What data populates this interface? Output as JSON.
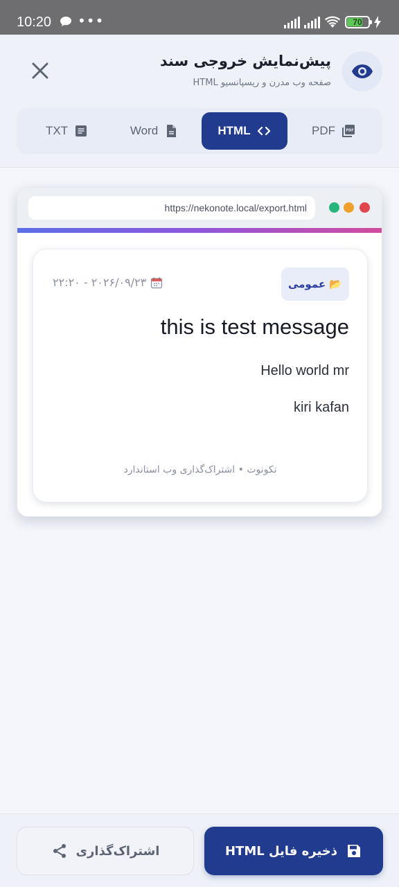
{
  "status_bar": {
    "time": "10:20",
    "dots": "•••",
    "battery": "70"
  },
  "header": {
    "title": "پیش‌نمایش خروجی سند",
    "subtitle": "صفحه وب مدرن و ریسپانسیو HTML"
  },
  "tabs": [
    {
      "label": "PDF",
      "icon": "pdf-icon",
      "active": false
    },
    {
      "label": "HTML",
      "icon": "code-icon",
      "active": true
    },
    {
      "label": "Word",
      "icon": "document-icon",
      "active": false
    },
    {
      "label": "TXT",
      "icon": "text-icon",
      "active": false
    }
  ],
  "browser": {
    "url": "https://nekonote.local/export.html",
    "dot_colors": [
      "#e0474c",
      "#f0a12b",
      "#26b67c"
    ]
  },
  "note": {
    "category": "📂 عمومی",
    "date": "۲۲:۲۰ - ۲۰۲۶/۰۹/۲۳",
    "title": "this is test message",
    "paragraphs": [
      "Hello world mr",
      "kiri kafan"
    ],
    "footer": "نکونوت • اشتراک‌گذاری وب استاندارد"
  },
  "actions": {
    "share_label": "اشتراک‌گذاری",
    "save_label": "ذخیره فایل HTML"
  },
  "colors": {
    "primary": "#213b8f",
    "background": "#f4f6fb"
  }
}
